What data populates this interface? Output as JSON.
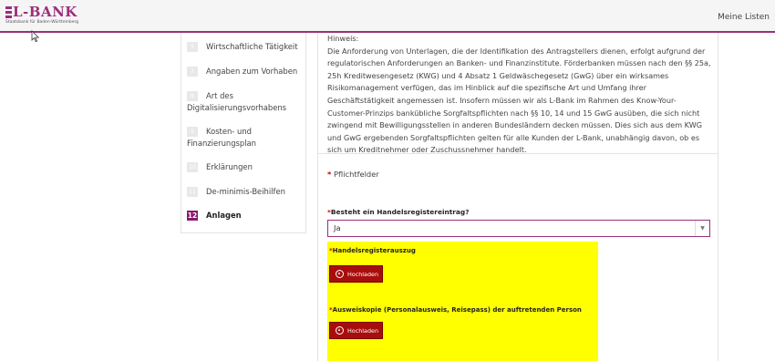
{
  "header": {
    "logo_text": "L-BANK",
    "logo_subtitle": "Staatsbank für Baden-Württemberg",
    "nav_link": "Meine Listen",
    "accent_color": "#9b2f7c"
  },
  "sidebar": {
    "steps": [
      {
        "number": "5",
        "label": "Wirtschaftliche Tätigkeit"
      },
      {
        "number": "7",
        "label": "Angaben zum Vorhaben"
      },
      {
        "number": "8",
        "label_line1": "Art des",
        "label_line2": "Digitalisierungsvorhabens"
      },
      {
        "number": "9",
        "label_line1": "Kosten- und",
        "label_line2": "Finanzierungsplan"
      },
      {
        "number": "10",
        "label": "Erklärungen"
      },
      {
        "number": "11",
        "label": "De-minimis-Beihilfen"
      },
      {
        "number": "12",
        "label": "Anlagen"
      }
    ],
    "active_step_color": "#8a1a6e"
  },
  "main": {
    "hint_title": "Hinweis:",
    "hint_text": "Die Anforderung von Unterlagen, die der Identifikation des Antragstellers dienen, erfolgt aufgrund der regulatorischen Anforderungen an Banken- und Finanzinstitute. Förderbanken müssen nach den §§ 25a, 25h Kreditwesengesetz (KWG) und 4 Absatz 1 Geldwäschegesetz (GwG) über ein wirksames Risikomanagement verfügen, das im Hinblick auf die spezifische Art und Umfang ihrer Geschäftstätigkeit angemessen ist. Insofern müssen wir als L-Bank im Rahmen des Know-Your-Customer-Prinzips bankübliche Sorgfaltspflichten nach §§ 10, 14 und 15 GwG ausüben, die sich nicht zwingend mit Bewilligungsstellen in anderen Bundesländern decken müssen. Dies sich aus dem KWG und GwG ergebenden Sorgfaltspflichten gelten für alle Kunden der L-Bank, unabhängig davon, ob es sich um Kreditnehmer oder Zuschussnehmer handelt.",
    "required_marker": "*",
    "required_note": "Pflichtfelder",
    "question_label": "Besteht ein Handelsregistereintrag?",
    "question_value": "Ja",
    "uploads": [
      {
        "label": "Handelsregisterauszug",
        "button": "Hochladen"
      },
      {
        "label": "Ausweiskopie (Personalausweis, Reisepass) der auftretenden Person",
        "button": "Hochladen"
      }
    ],
    "highlight_color": "#ffff00",
    "button_color": "#a80d0d"
  }
}
